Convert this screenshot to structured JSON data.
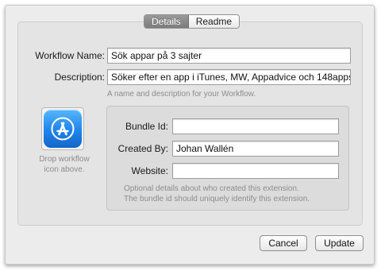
{
  "tabs": [
    {
      "label": "Details",
      "active": true
    },
    {
      "label": "Readme",
      "active": false
    }
  ],
  "form": {
    "workflow_name_label": "Workflow Name:",
    "workflow_name_value": "Sök appar på 3 sajter",
    "description_label": "Description:",
    "description_value": "Söker efter en app i iTunes, MW, Appadvice och 148apps",
    "name_hint": "A name and description for your Workflow."
  },
  "icon_well": {
    "icon": "app-store-icon",
    "caption_line1": "Drop workflow",
    "caption_line2": "icon above."
  },
  "extension": {
    "bundle_id_label": "Bundle Id:",
    "bundle_id_value": "",
    "created_by_label": "Created By:",
    "created_by_value": "Johan Wallén",
    "website_label": "Website:",
    "website_value": "",
    "hint_line1": "Optional details about who created this extension.",
    "hint_line2": "The bundle id should uniquely identify this extension."
  },
  "buttons": {
    "cancel": "Cancel",
    "update": "Update"
  },
  "colors": {
    "window_bg": "#ececec",
    "panel_bg": "#e4e4e4",
    "icon_blue": "#1f84ea"
  }
}
